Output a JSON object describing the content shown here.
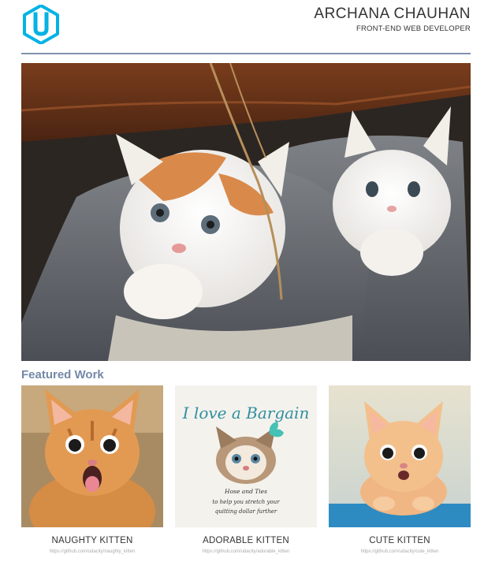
{
  "header": {
    "name": "ARCHANA CHAUHAN",
    "role": "FRONT-END WEB DEVELOPER",
    "logo_icon": "udacity-logo-icon"
  },
  "colors": {
    "logo": "#02b3e4",
    "rule": "#7f93ad",
    "section_heading": "#7389a7"
  },
  "hero": {
    "image_icon": "kittens-in-shoes-photo"
  },
  "featured": {
    "heading": "Featured Work",
    "items": [
      {
        "title": "NAUGHTY KITTEN",
        "link": "https://github.com/udacity/naughty_kitten"
      },
      {
        "title": "ADORABLE KITTEN",
        "link": "https://github.com/udacity/adorable_kitten"
      },
      {
        "title": "CUTE KITTEN",
        "link": "https://github.com/udacity/cute_kitten"
      }
    ],
    "poster": {
      "headline": "I love a Bargain",
      "line1": "Hose and Ties",
      "line2": "to help you stretch your",
      "line3": "quitting dollar further"
    }
  }
}
